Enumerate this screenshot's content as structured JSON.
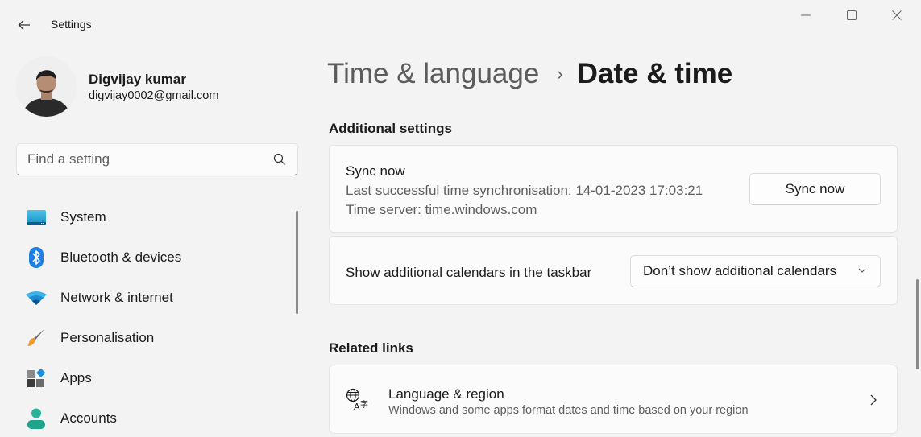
{
  "window": {
    "title": "Settings",
    "controls": {
      "minimize": "minimize",
      "maximize": "maximize",
      "close": "close"
    }
  },
  "profile": {
    "name": "Digvijay kumar",
    "email": "digvijay0002@gmail.com"
  },
  "search": {
    "placeholder": "Find a setting",
    "value": ""
  },
  "sidebar": {
    "items": [
      {
        "label": "System",
        "icon": "system-icon"
      },
      {
        "label": "Bluetooth & devices",
        "icon": "bluetooth-icon"
      },
      {
        "label": "Network & internet",
        "icon": "wifi-icon"
      },
      {
        "label": "Personalisation",
        "icon": "paintbrush-icon"
      },
      {
        "label": "Apps",
        "icon": "apps-icon"
      },
      {
        "label": "Accounts",
        "icon": "person-icon"
      }
    ]
  },
  "breadcrumb": {
    "parent": "Time & language",
    "separator": "›",
    "current": "Date & time"
  },
  "additional_settings": {
    "title": "Additional settings",
    "sync": {
      "title": "Sync now",
      "last_sync": "Last successful time synchronisation: 14-01-2023 17:03:21",
      "server": "Time server: time.windows.com",
      "button_label": "Sync now"
    },
    "calendars": {
      "label": "Show additional calendars in the taskbar",
      "selected": "Don’t show additional calendars"
    }
  },
  "related_links": {
    "title": "Related links",
    "items": [
      {
        "title": "Language & region",
        "description": "Windows and some apps format dates and time based on your region",
        "icon": "language-icon"
      }
    ]
  }
}
